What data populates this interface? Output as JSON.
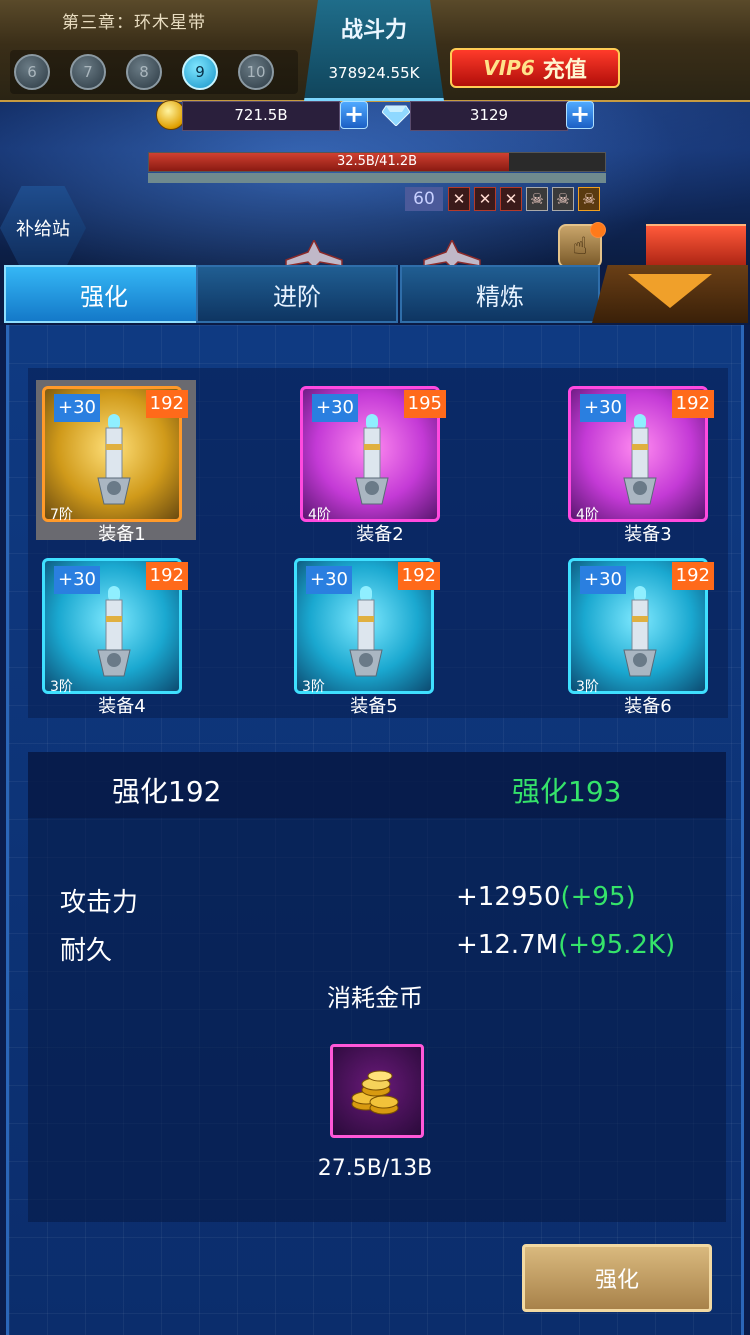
{
  "header": {
    "chapter_title": "第三章：环木星带",
    "stages": [
      "6",
      "7",
      "8",
      "9",
      "10"
    ],
    "active_stage": "9",
    "power_label": "战斗力",
    "power_value": "378924.55K",
    "vip_level": "VIP6",
    "vip_recharge": "充值"
  },
  "currency": {
    "gold": "721.5B",
    "diamonds": "3129"
  },
  "boss": {
    "hp_text": "32.5B/41.2B",
    "hp_fraction": 0.789,
    "level": "60",
    "skulls": [
      "✕",
      "✕",
      "✕",
      "☠",
      "☠",
      "☠"
    ]
  },
  "supply_station": "补给站",
  "tabs": [
    "强化",
    "进阶",
    "精炼"
  ],
  "active_tab": "强化",
  "equipment": [
    {
      "bonus": "+30",
      "level": "192",
      "grade": "7阶",
      "name": "装备1",
      "quality": "gold",
      "selected": true
    },
    {
      "bonus": "+30",
      "level": "195",
      "grade": "4阶",
      "name": "装备2",
      "quality": "purple",
      "selected": false
    },
    {
      "bonus": "+30",
      "level": "192",
      "grade": "4阶",
      "name": "装备3",
      "quality": "purple",
      "selected": false
    },
    {
      "bonus": "+30",
      "level": "192",
      "grade": "3阶",
      "name": "装备4",
      "quality": "cyan",
      "selected": false
    },
    {
      "bonus": "+30",
      "level": "192",
      "grade": "3阶",
      "name": "装备5",
      "quality": "cyan",
      "selected": false
    },
    {
      "bonus": "+30",
      "level": "192",
      "grade": "3阶",
      "name": "装备6",
      "quality": "cyan",
      "selected": false
    }
  ],
  "upgrade": {
    "current": "强化192",
    "next": "强化193",
    "stats": [
      {
        "label": "攻击力",
        "value": "+12950",
        "delta": "(+95)"
      },
      {
        "label": "耐久",
        "value": "+12.7M",
        "delta": "(+95.2K)"
      }
    ],
    "cost_title": "消耗金币",
    "cost_value": "27.5B/13B",
    "button_label": "强化"
  },
  "colors": {
    "accent_green": "#35e36a",
    "tab_active": "#1479c9",
    "badge_orange": "#ff6a1a",
    "badge_blue": "#2a7fe0"
  }
}
